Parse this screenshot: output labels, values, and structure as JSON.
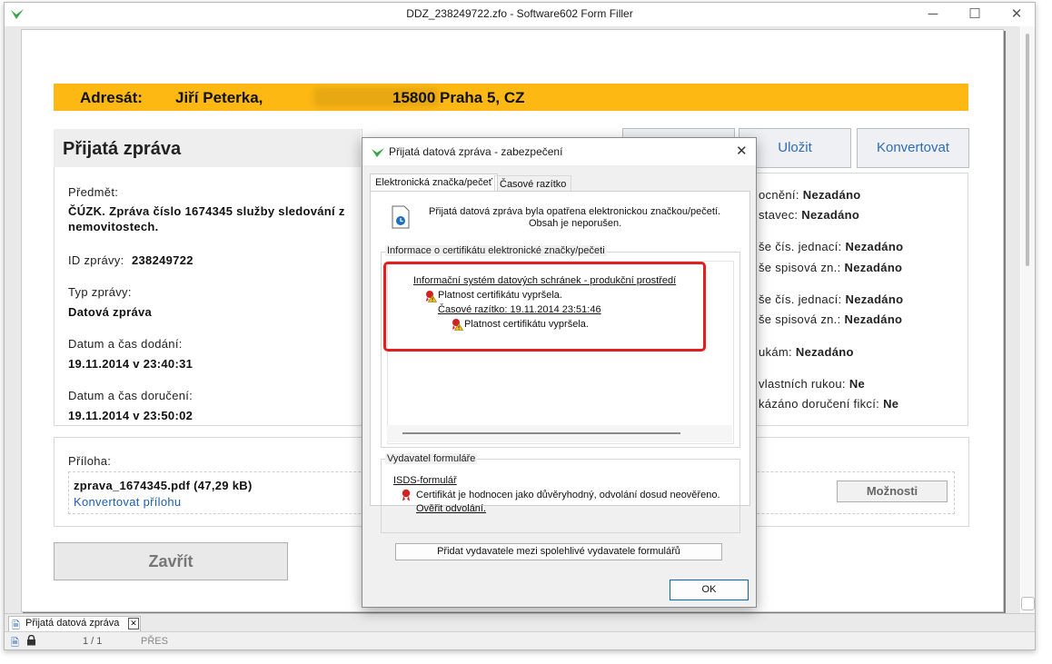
{
  "window": {
    "title": "DDZ_238249722.zfo - Software602 Form Filler",
    "controls": [
      "minimize",
      "maximize",
      "close"
    ]
  },
  "header": {
    "addressee_label": "Adresát:",
    "addressee_value": "Jiří Peterka,",
    "addressee_city": "15800 Praha 5, CZ"
  },
  "received": {
    "heading": "Přijatá zpráva",
    "subject_label": "Předmět:",
    "subject_value_line1": "ČÚZK. Zpráva číslo 1674345 služby sledování z",
    "subject_value_line2": "nemovitostech.",
    "id_label": "ID zprávy:",
    "id_value": "238249722",
    "type_label": "Typ zprávy:",
    "type_value": "Datová zpráva",
    "delivered_label": "Datum a čas dodání:",
    "delivered_value": "19.11.2014 v 23:40:31",
    "accepted_label": "Datum a čas doručení:",
    "accepted_value": "19.11.2014 v 23:50:02"
  },
  "actions": {
    "save": "Uložit",
    "convert": "Konvertovat"
  },
  "details": [
    {
      "label": "ocnění:",
      "value": "Nezadáno"
    },
    {
      "label": "stavec:",
      "value": "Nezadáno"
    },
    {
      "label": "še čís. jednací:",
      "value": "Nezadáno"
    },
    {
      "label": "še spisová zn.:",
      "value": "Nezadáno"
    },
    {
      "label": "še čís. jednací:",
      "value": "Nezadáno"
    },
    {
      "label": "še spisová zn.:",
      "value": "Nezadáno"
    },
    {
      "label": "ukám:",
      "value": "Nezadáno"
    },
    {
      "label": "vlastních rukou:",
      "value": "Ne"
    },
    {
      "label": "kázáno doručení fikcí:",
      "value": "Ne"
    }
  ],
  "attachment": {
    "label": "Příloha:",
    "file": "zprava_1674345.pdf (47,29 kB)",
    "convert_link": "Konvertovat přílohu",
    "options_button": "Možnosti"
  },
  "close_button": "Zavřít",
  "tabs": {
    "doc_tab": "Přijatá datová zpráva",
    "close_symbol": "✕"
  },
  "status": {
    "pages": "1 / 1",
    "mode": "PŘES"
  },
  "dialog": {
    "title": "Přijatá datová zpráva - zabezpečení",
    "tab_seal": "Elektronická značka/pečeť",
    "tab_timestamp": "Časové razítko",
    "info_line1": "Přijatá datová zpráva byla opatřena  elektronickou značkou/pečetí.",
    "info_line2": "Obsah je neporušen.",
    "cert_group_label": "Informace o certifikátu elektronické značky/pečeti",
    "cert_issuer": "Informační systém datových schránek - produkční prostředí",
    "cert_status": "Platnost certifikátu vypršela.",
    "timestamp_link": "Časové razítko: 19.11.2014 23:51:46",
    "timestamp_status": "Platnost certifikátu vypršela.",
    "publisher_group_label": "Vydavatel formuláře",
    "publisher_link": "ISDS-formulář",
    "publisher_status": "Certifikát je hodnocen jako důvěryhodný, odvolání dosud neověřeno.",
    "verify_link": "Ověřit odvolání.",
    "add_publisher_button": "Přidat vydavatele mezi spolehlivé vydavatele formulářů",
    "ok_button": "OK"
  },
  "colors": {
    "accent_yellow": "#fdb813",
    "link_blue": "#1f5fb0",
    "highlight_red": "#e02020"
  }
}
